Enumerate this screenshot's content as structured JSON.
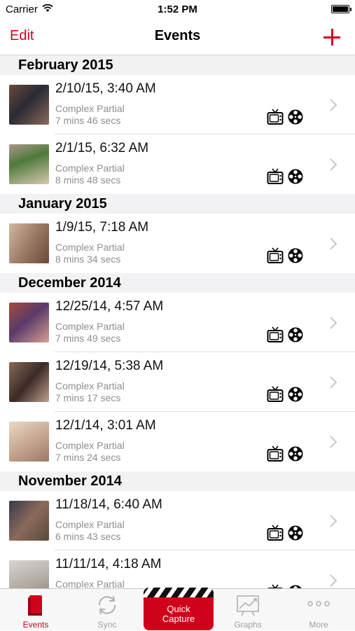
{
  "status_bar": {
    "carrier": "Carrier",
    "time": "1:52 PM"
  },
  "nav": {
    "edit_label": "Edit",
    "title": "Events"
  },
  "sections": [
    {
      "header": "February 2015",
      "events": [
        {
          "title": "2/10/15, 3:40 AM",
          "type": "Complex Partial",
          "duration": "7 mins 46 secs"
        },
        {
          "title": "2/1/15, 6:32 AM",
          "type": "Complex Partial",
          "duration": "8 mins 48 secs"
        }
      ]
    },
    {
      "header": "January 2015",
      "events": [
        {
          "title": "1/9/15, 7:18 AM",
          "type": "Complex Partial",
          "duration": "8 mins 34 secs"
        }
      ]
    },
    {
      "header": "December 2014",
      "events": [
        {
          "title": "12/25/14, 4:57 AM",
          "type": "Complex Partial",
          "duration": "7 mins 49 secs"
        },
        {
          "title": "12/19/14, 5:38 AM",
          "type": "Complex Partial",
          "duration": "7 mins 17 secs"
        },
        {
          "title": "12/1/14, 3:01 AM",
          "type": "Complex Partial",
          "duration": "7 mins 24 secs"
        }
      ]
    },
    {
      "header": "November 2014",
      "events": [
        {
          "title": "11/18/14, 6:40 AM",
          "type": "Complex Partial",
          "duration": "6 mins 43 secs"
        },
        {
          "title": "11/11/14, 4:18 AM",
          "type": "Complex Partial",
          "duration": ""
        }
      ]
    }
  ],
  "tabbar": {
    "events_label": "Events",
    "sync_label": "Sync",
    "quick_capture_line1": "Quick",
    "quick_capture_line2": "Capture",
    "graphs_label": "Graphs",
    "more_label": "More"
  },
  "icons": {
    "tv": "tv-icon",
    "reel": "film-reel-icon",
    "chevron": "chevron-right-icon"
  },
  "colors": {
    "accent": "#d0021b",
    "secondary_text": "#8e8e93",
    "section_bg": "#f2f2f4"
  }
}
